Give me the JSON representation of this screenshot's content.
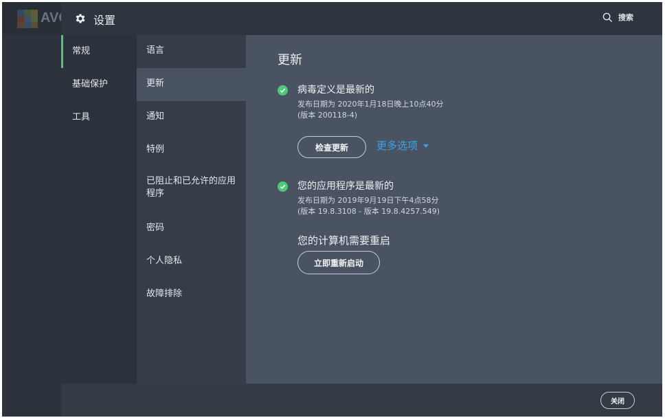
{
  "background_app": {
    "logo_text": "AVG"
  },
  "titlebar": {
    "title": "设置",
    "search_label": "搜索"
  },
  "nav_primary": [
    {
      "label": "常规",
      "active": true
    },
    {
      "label": "基础保护",
      "active": false
    },
    {
      "label": "工具",
      "active": false
    }
  ],
  "nav_secondary": [
    {
      "label": "语言",
      "active": false
    },
    {
      "label": "更新",
      "active": true
    },
    {
      "label": "通知",
      "active": false
    },
    {
      "label": "特例",
      "active": false
    },
    {
      "label": "已阻止和已允许的应用程序",
      "active": false
    },
    {
      "label": "密码",
      "active": false
    },
    {
      "label": "个人隐私",
      "active": false
    },
    {
      "label": "故障排除",
      "active": false
    }
  ],
  "content": {
    "title": "更新",
    "virus_defs": {
      "heading": "病毒定义是最新的",
      "release": "发布日期为 2020年1月18日晚上10点40分",
      "version": "(版本 200118-4)",
      "check_button": "检查更新",
      "more_options": "更多选项"
    },
    "app": {
      "heading": "您的应用程序是最新的",
      "release": "发布日期为 2019年9月19日下午4点58分",
      "version": "(版本 19.8.3108 - 版本 19.8.4257.549)"
    },
    "restart": {
      "text": "您的计算机需要重启",
      "button": "立即重新启动"
    }
  },
  "footer": {
    "close_label": "关闭"
  },
  "colors": {
    "accent_green": "#4ec97a",
    "link_blue": "#3aa3f0",
    "titlebar": "#2f353e",
    "content_bg": "#4a5361"
  }
}
